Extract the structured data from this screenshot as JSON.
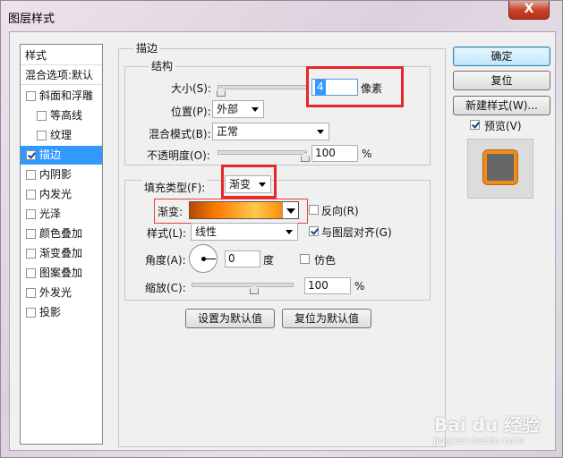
{
  "window": {
    "title": "图层样式",
    "close_symbol": "X"
  },
  "left_panel": {
    "header_styles": "样式",
    "header_blending": "混合选项:默认",
    "items": [
      {
        "label": "斜面和浮雕",
        "checked": false
      },
      {
        "label": "等高线",
        "checked": false
      },
      {
        "label": "纹理",
        "checked": false
      },
      {
        "label": "描边",
        "checked": true
      },
      {
        "label": "内阴影",
        "checked": false
      },
      {
        "label": "内发光",
        "checked": false
      },
      {
        "label": "光泽",
        "checked": false
      },
      {
        "label": "颜色叠加",
        "checked": false
      },
      {
        "label": "渐变叠加",
        "checked": false
      },
      {
        "label": "图案叠加",
        "checked": false
      },
      {
        "label": "外发光",
        "checked": false
      },
      {
        "label": "投影",
        "checked": false
      }
    ]
  },
  "stroke": {
    "group_title": "描边",
    "structure_title": "结构",
    "size_label": "大小(S):",
    "size_value": "4",
    "size_unit": "像素",
    "position_label": "位置(P):",
    "position_value": "外部",
    "blend_label": "混合模式(B):",
    "blend_value": "正常",
    "opacity_label": "不透明度(O):",
    "opacity_value": "100",
    "opacity_unit": "%",
    "fill_type_label": "填充类型(F):",
    "fill_type_value": "渐变",
    "gradient_label": "渐变:",
    "reverse_label": "反向(R)",
    "reverse_checked": false,
    "style_label": "样式(L):",
    "style_value": "线性",
    "align_label": "与图层对齐(G)",
    "align_checked": true,
    "angle_label": "角度(A):",
    "angle_value": "0",
    "angle_unit": "度",
    "dither_label": "仿色",
    "dither_checked": false,
    "scale_label": "缩放(C):",
    "scale_value": "100",
    "scale_unit": "%",
    "set_default_button": "设置为默认值",
    "reset_default_button": "复位为默认值"
  },
  "right_buttons": {
    "ok": "确定",
    "reset": "复位",
    "new_style": "新建样式(W)...",
    "preview_label": "预览(V)",
    "preview_checked": true
  },
  "watermark": {
    "brand": "Bai du 经验",
    "sub": "jingyan.baidu.com"
  },
  "colors": {
    "selection": "#3399ff",
    "highlight_red": "#e8262b",
    "stroke_orange": "#f08c1c"
  }
}
